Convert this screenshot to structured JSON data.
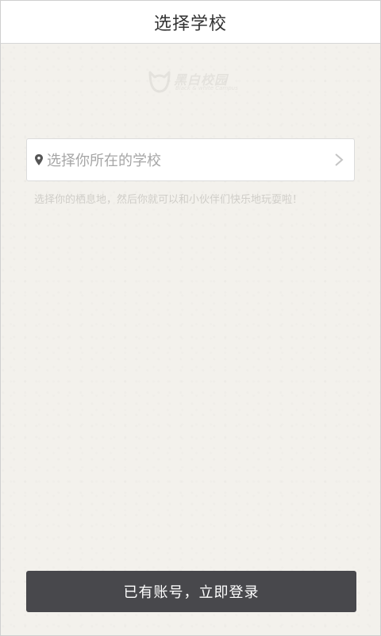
{
  "header": {
    "title": "选择学校"
  },
  "logo": {
    "brand": "黑白校园",
    "tagline": "Black & white Campus",
    "icon": "campus-logo-icon"
  },
  "school_select": {
    "placeholder": "选择你所在的学校",
    "leading_icon": "location-pin-icon",
    "trailing_icon": "chevron-right-icon"
  },
  "hint": {
    "text": "选择你的栖息地，然后你就可以和小伙伴们快乐地玩耍啦！"
  },
  "footer": {
    "login_label": "已有账号，立即登录"
  },
  "colors": {
    "background": "#f3f1ec",
    "titlebar": "#ffffff",
    "button": "#48484c",
    "placeholder": "#a6a6a6",
    "hint": "#cfcdc8"
  }
}
